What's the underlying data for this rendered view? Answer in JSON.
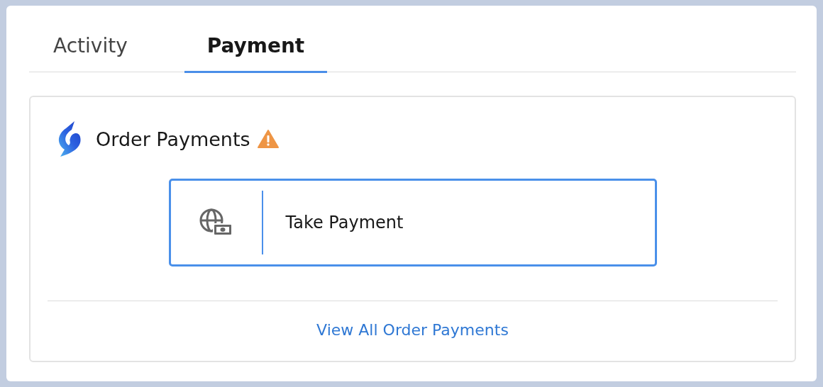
{
  "tabs": [
    {
      "label": "Activity",
      "selected": false
    },
    {
      "label": "Payment",
      "selected": true
    }
  ],
  "card": {
    "title": "Order Payments",
    "warning": true,
    "action": {
      "label": "Take Payment",
      "focused": true
    },
    "link": "View All Order Payments"
  }
}
